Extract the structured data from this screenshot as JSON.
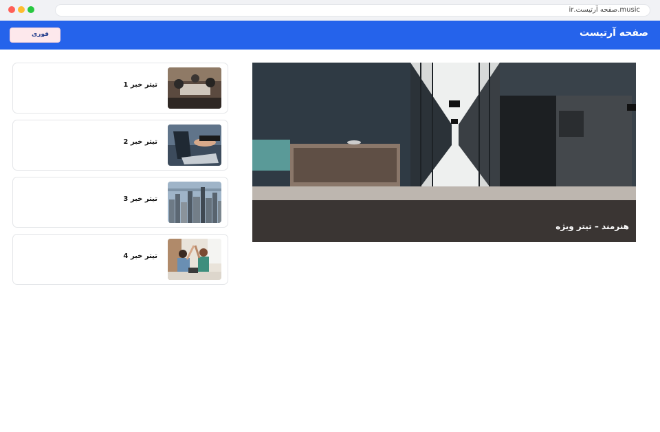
{
  "browser": {
    "url": "music.صفحه آرتیست.ir"
  },
  "header": {
    "title": "صفحه آرتیست",
    "urgent_button": "فوری",
    "accent_color": "#2563eb"
  },
  "featured": {
    "caption": "هنرمند – تیتر ویژه",
    "image_icon": "office-hallway-image"
  },
  "news": [
    {
      "title": "تیتر خبر 1",
      "image_icon": "team-meeting-image"
    },
    {
      "title": "تیتر خبر 2",
      "image_icon": "laptop-typing-image"
    },
    {
      "title": "تیتر خبر 3",
      "image_icon": "city-skyline-image"
    },
    {
      "title": "تیتر خبر 4",
      "image_icon": "high-five-image"
    }
  ]
}
